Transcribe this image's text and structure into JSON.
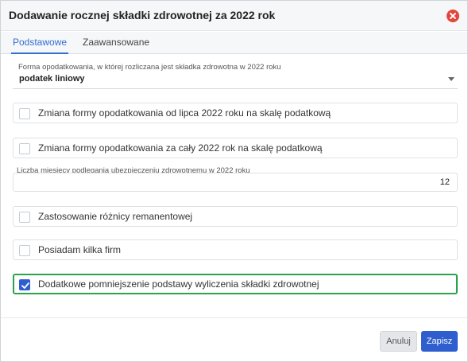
{
  "dialog": {
    "title": "Dodawanie rocznej składki zdrowotnej za 2022 rok",
    "close_icon": "close-circle-icon"
  },
  "tabs": [
    {
      "label": "Podstawowe",
      "active": true
    },
    {
      "label": "Zaawansowane",
      "active": false
    }
  ],
  "form": {
    "taxation_form": {
      "label": "Forma opodatkowania, w której rozliczana jest składka zdrowotna w 2022 roku",
      "value": "podatek liniowy"
    },
    "checkboxes_top": [
      {
        "label": "Zmiana formy opodatkowania od lipca 2022 roku na skalę podatkową",
        "checked": false
      },
      {
        "label": "Zmiana formy opodatkowania za cały 2022 rok na skalę podatkową",
        "checked": false
      }
    ],
    "months_insured": {
      "label": "Liczba miesięcy podlegania ubezpieczeniu zdrowotnemu w 2022 roku",
      "value": "12"
    },
    "checkboxes_bottom": [
      {
        "label": "Zastosowanie różnicy remanentowej",
        "checked": false
      },
      {
        "label": "Posiadam kilka firm",
        "checked": false
      },
      {
        "label": "Dodatkowe pomniejszenie podstawy wyliczenia składki zdrowotnej",
        "checked": true
      }
    ]
  },
  "footer": {
    "cancel_label": "Anuluj",
    "save_label": "Zapisz"
  },
  "colors": {
    "accent": "#2f5fcf",
    "tab_active": "#2f6fd2",
    "close": "#e3463c",
    "highlight_border": "#2ca34b"
  }
}
